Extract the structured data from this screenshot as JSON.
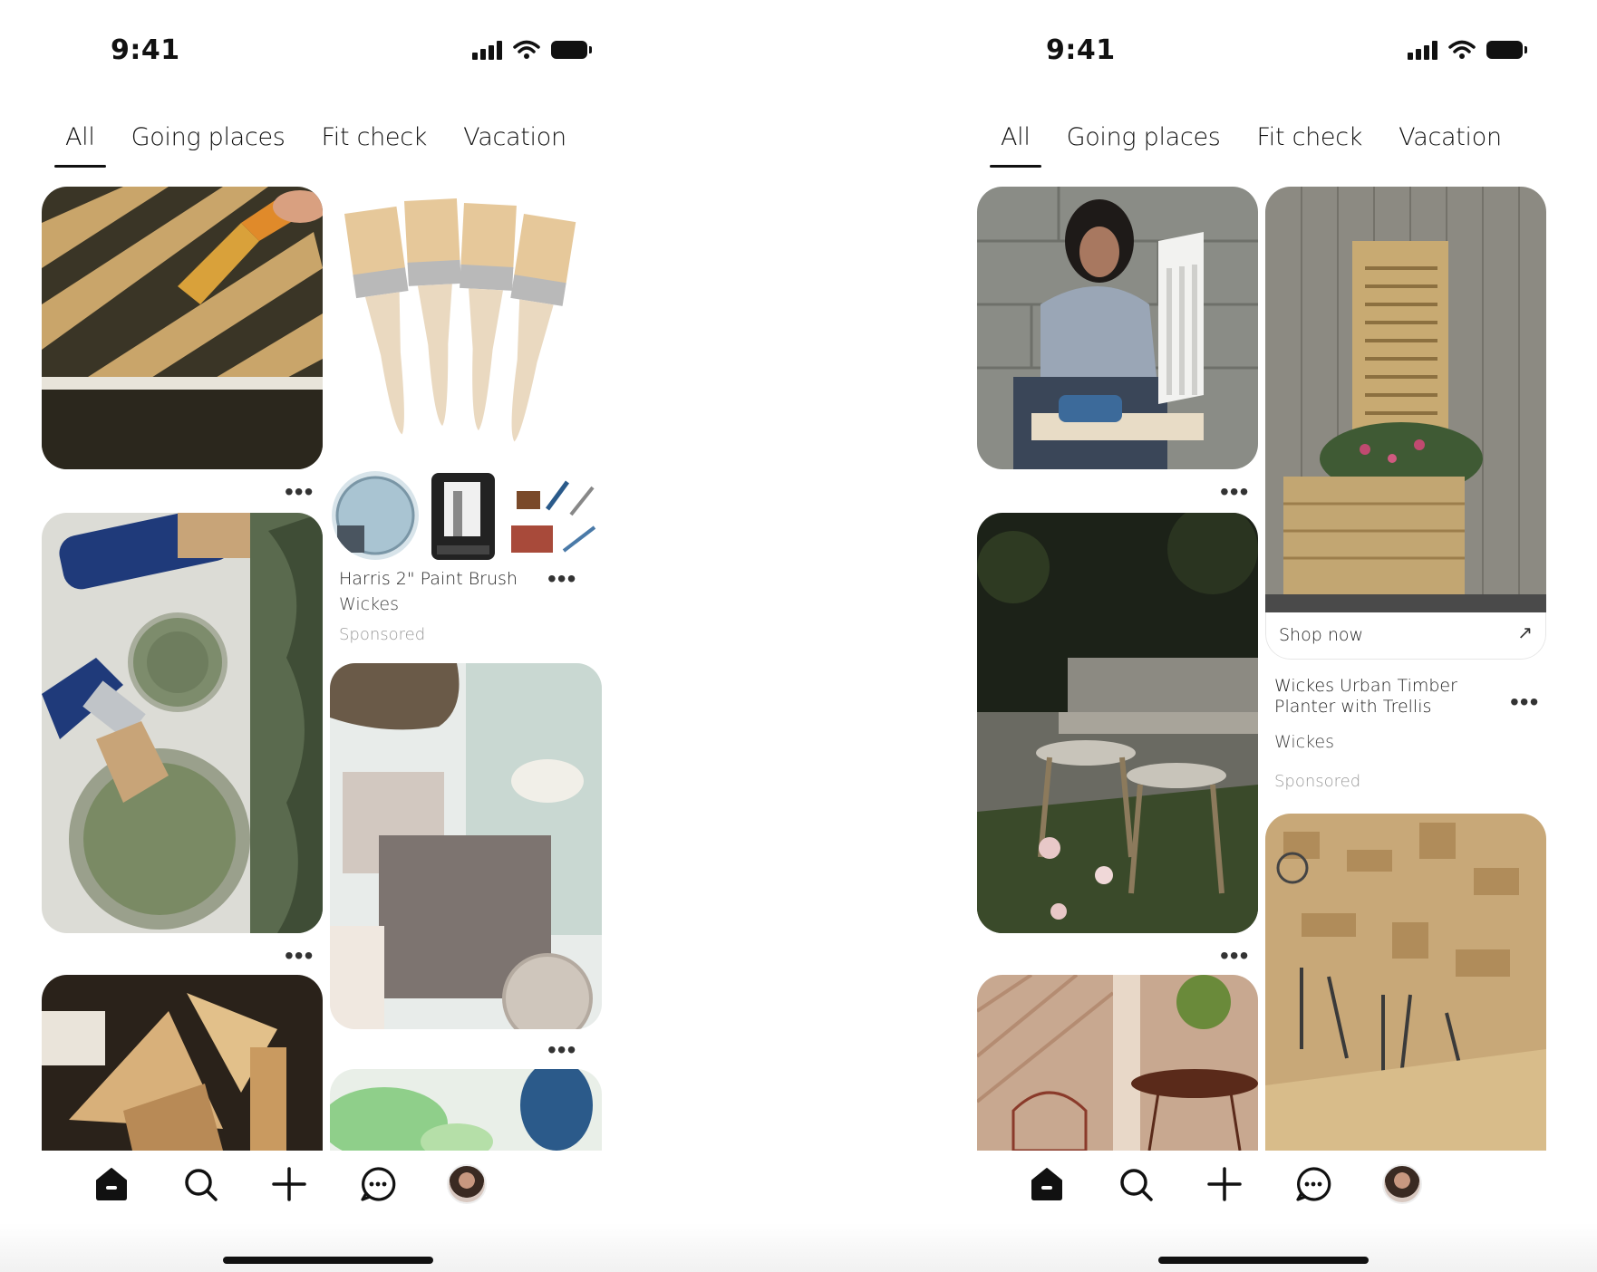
{
  "screens": [
    {
      "status_time": "9:41",
      "tabs": [
        {
          "label": "All",
          "active": true
        },
        {
          "label": "Going places",
          "active": false
        },
        {
          "label": "Fit check",
          "active": false
        },
        {
          "label": "Vacation",
          "active": false
        }
      ],
      "sponsored_pin": {
        "title": "Harris  2\" Paint Brush",
        "advertiser": "Wickes",
        "sponsored_label": "Sponsored"
      }
    },
    {
      "status_time": "9:41",
      "tabs": [
        {
          "label": "All",
          "active": true
        },
        {
          "label": "Going places",
          "active": false
        },
        {
          "label": "Fit check",
          "active": false
        },
        {
          "label": "Vacation",
          "active": false
        }
      ],
      "shop_now_label": "Shop now",
      "sponsored_pin": {
        "title": "Wickes Urban Timber Planter with Trellis",
        "advertiser": "Wickes",
        "sponsored_label": "Sponsored"
      }
    }
  ],
  "more_glyph": "•••",
  "nav_icons": [
    "home-icon",
    "search-icon",
    "plus-icon",
    "chat-icon",
    "profile-avatar"
  ],
  "colors": {
    "text": "#111111",
    "muted": "#999999",
    "background": "#ffffff"
  }
}
